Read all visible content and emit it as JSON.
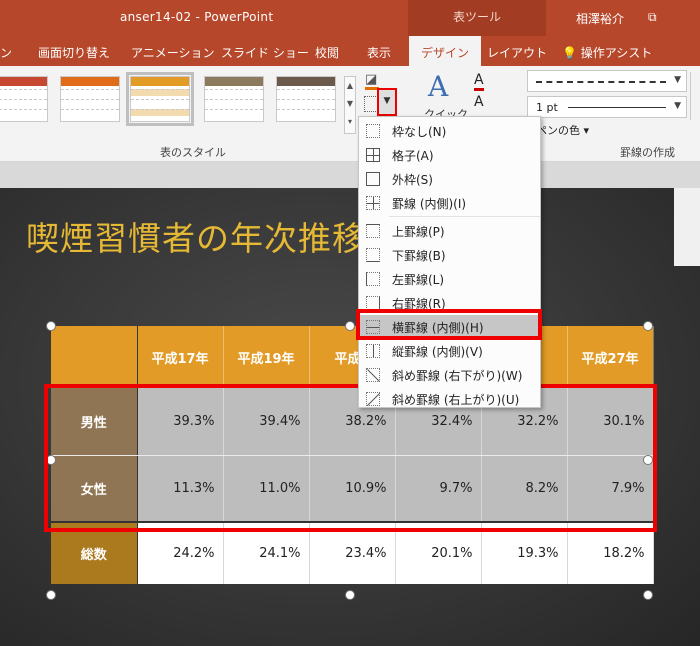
{
  "titlebar": {
    "document": "anser14-02  -  PowerPoint",
    "tool_tab": "表ツール",
    "user": "相澤裕介",
    "restore_icon": "restore-icon"
  },
  "tabs": [
    {
      "label": "ン"
    },
    {
      "label": "画面切り替え"
    },
    {
      "label": "アニメーション"
    },
    {
      "label": "スライド ショー"
    },
    {
      "label": "校閲"
    },
    {
      "label": "表示"
    },
    {
      "label": "デザイン"
    },
    {
      "label": "レイアウト"
    },
    {
      "label": "操作アシスト"
    }
  ],
  "ribbon": {
    "group_table_styles": "表のスタイル",
    "group_borders": "罫線の作成",
    "quick_label": "クイック",
    "line_weight": "1 pt",
    "pen_color": "ペンの色"
  },
  "slide": {
    "title": "喫煙習慣者の年次推移"
  },
  "table": {
    "headers": [
      "",
      "平成17年",
      "平成19年",
      "平成2",
      "",
      "年",
      "平成27年"
    ],
    "rows": [
      {
        "label": "男性",
        "values": [
          "39.3%",
          "39.4%",
          "38.2%",
          "32.4%",
          "32.2%",
          "30.1%"
        ]
      },
      {
        "label": "女性",
        "values": [
          "11.3%",
          "11.0%",
          "10.9%",
          "9.7%",
          "8.2%",
          "7.9%"
        ]
      },
      {
        "label": "総数",
        "values": [
          "24.2%",
          "24.1%",
          "23.4%",
          "20.1%",
          "19.3%",
          "18.2%"
        ]
      }
    ]
  },
  "menu": {
    "items": [
      "枠なし(N)",
      "格子(A)",
      "外枠(S)",
      "罫線 (内側)(I)",
      "上罫線(P)",
      "下罫線(B)",
      "左罫線(L)",
      "右罫線(R)",
      "横罫線 (内側)(H)",
      "縦罫線 (内側)(V)",
      "斜め罫線 (右下がり)(W)",
      "斜め罫線 (右上がり)(U)"
    ]
  },
  "colors": {
    "title_bar": "#b7472a",
    "slide_title": "#e6b935",
    "header_fill": "#e19b26",
    "highlight": "#e00000"
  }
}
